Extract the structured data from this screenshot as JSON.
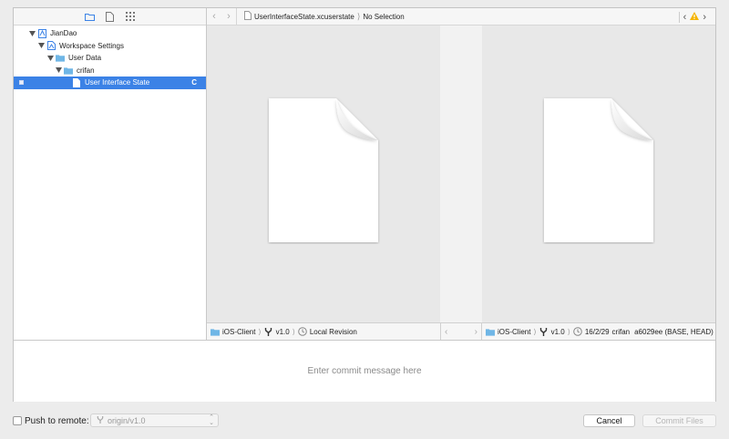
{
  "navigator": {
    "tabs": [
      "folder-icon",
      "file-icon",
      "grid-icon"
    ],
    "tree": [
      {
        "label": "JianDao",
        "indent": 0,
        "icon": "project-icon",
        "expanded": true
      },
      {
        "label": "Workspace Settings",
        "indent": 1,
        "icon": "workspace-icon",
        "expanded": true
      },
      {
        "label": "User Data",
        "indent": 2,
        "icon": "folder-icon",
        "expanded": true
      },
      {
        "label": "crifan",
        "indent": 3,
        "icon": "folder-icon",
        "expanded": true
      },
      {
        "label": "User Interface State",
        "indent": 4,
        "icon": "file-icon",
        "selected": true,
        "badge": "C"
      }
    ]
  },
  "jumpbar": {
    "file": "UserInterfaceState.xcuserstate",
    "selection": "No Selection"
  },
  "status_left": {
    "repo": "iOS-Client",
    "branch": "v1.0",
    "revision": "Local Revision"
  },
  "status_right": {
    "repo": "iOS-Client",
    "branch": "v1.0",
    "date": "16/2/29",
    "author": "crifan",
    "commit": "a6029ee (BASE, HEAD)"
  },
  "commit": {
    "placeholder": "Enter commit message here"
  },
  "bottom": {
    "push_label": "Push to remote:",
    "remote": "origin/v1.0",
    "cancel": "Cancel",
    "commit_files": "Commit Files"
  },
  "colors": {
    "selection": "#3b82e6",
    "warning": "#f5b400",
    "folder": "#6fb6e6"
  }
}
